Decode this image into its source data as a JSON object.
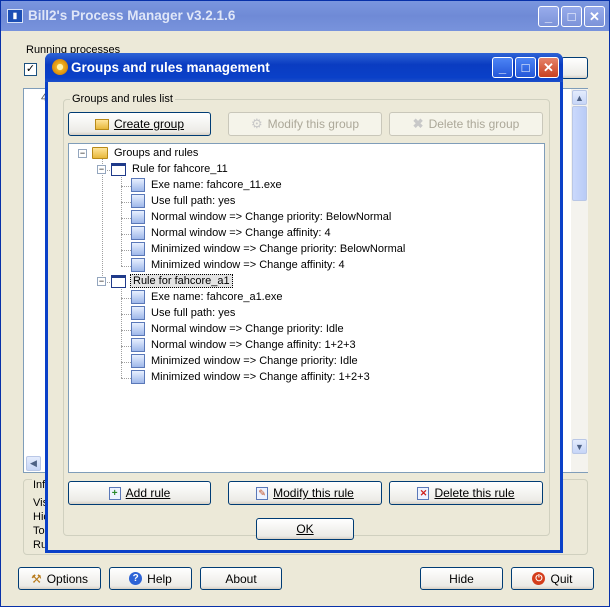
{
  "main_window": {
    "title": "Bill2's Process Manager v3.2.1.6",
    "running_label": "Running processes",
    "info_label": "Inf",
    "info_lines": [
      "Vis",
      "Hic",
      "To",
      "Ru"
    ],
    "col_fragment": "4",
    "buttons": {
      "options": "Options",
      "help": "Help",
      "about": "About",
      "hide": "Hide",
      "quit": "Quit"
    }
  },
  "dialog": {
    "title": "Groups and rules management",
    "group_label": "Groups and rules list",
    "buttons": {
      "create_group": "Create group",
      "modify_group": "Modify this group",
      "delete_group": "Delete this group",
      "add_rule": "Add rule",
      "modify_rule": "Modify this rule",
      "delete_rule": "Delete this rule",
      "ok": "OK"
    },
    "tree": {
      "root": "Groups and rules",
      "rules": [
        {
          "name": "Rule for fahcore_11",
          "items": [
            "Exe name: fahcore_11.exe",
            "Use full path: yes",
            "Normal window => Change priority: BelowNormal",
            "Normal window => Change affinity: 4",
            "Minimized window => Change priority: BelowNormal",
            "Minimized window => Change affinity: 4"
          ]
        },
        {
          "name": "Rule for fahcore_a1",
          "selected": true,
          "items": [
            "Exe name: fahcore_a1.exe",
            "Use full path: yes",
            "Normal window => Change priority: Idle",
            "Normal window => Change affinity: 1+2+3",
            "Minimized window => Change priority: Idle",
            "Minimized window => Change affinity: 1+2+3"
          ]
        }
      ]
    }
  },
  "colors": {
    "title_active": "#0a40c8",
    "title_inactive": "#7a96df",
    "face": "#ece9d8",
    "accent_border": "#003c74"
  },
  "icons": {
    "app": "process-manager-icon",
    "dialog": "gear-icon",
    "create_group": "folder-icon",
    "modify_group": "gear-icon",
    "delete_group": "x-icon",
    "add_rule": "add-icon",
    "modify_rule": "edit-icon",
    "delete_rule": "delete-icon",
    "options": "tools-icon",
    "help": "help-icon",
    "quit": "power-icon"
  }
}
